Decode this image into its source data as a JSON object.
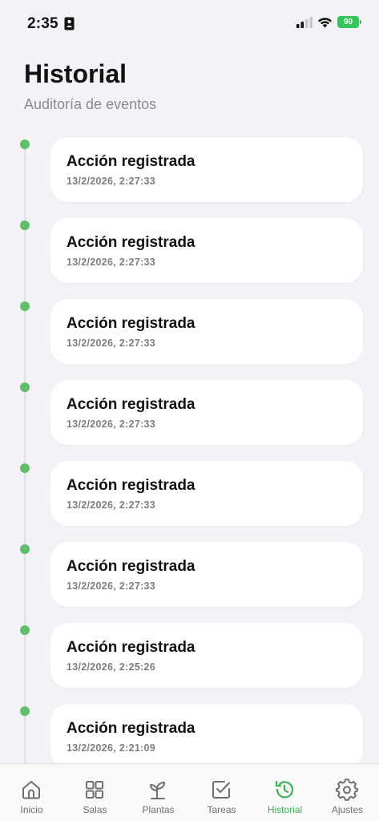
{
  "status_bar": {
    "time": "2:35",
    "battery": "90"
  },
  "header": {
    "title": "Historial",
    "subtitle": "Auditoría de eventos"
  },
  "events": [
    {
      "title": "Acción registrada",
      "timestamp": "13/2/2026, 2:27:33"
    },
    {
      "title": "Acción registrada",
      "timestamp": "13/2/2026, 2:27:33"
    },
    {
      "title": "Acción registrada",
      "timestamp": "13/2/2026, 2:27:33"
    },
    {
      "title": "Acción registrada",
      "timestamp": "13/2/2026, 2:27:33"
    },
    {
      "title": "Acción registrada",
      "timestamp": "13/2/2026, 2:27:33"
    },
    {
      "title": "Acción registrada",
      "timestamp": "13/2/2026, 2:27:33"
    },
    {
      "title": "Acción registrada",
      "timestamp": "13/2/2026, 2:25:26"
    },
    {
      "title": "Acción registrada",
      "timestamp": "13/2/2026, 2:21:09"
    }
  ],
  "tab_bar": {
    "tabs": [
      {
        "label": "Inicio",
        "icon": "home-icon",
        "active": false
      },
      {
        "label": "Salas",
        "icon": "grid-icon",
        "active": false
      },
      {
        "label": "Plantas",
        "icon": "sprout-icon",
        "active": false
      },
      {
        "label": "Tareas",
        "icon": "checkbox-icon",
        "active": false
      },
      {
        "label": "Historial",
        "icon": "history-icon",
        "active": true
      },
      {
        "label": "Ajustes",
        "icon": "gear-icon",
        "active": false
      }
    ]
  },
  "colors": {
    "accent": "#3fae55",
    "timeline_dot": "#5fbf6a",
    "background": "#f2f2f7",
    "card": "#ffffff",
    "battery": "#33c759"
  }
}
